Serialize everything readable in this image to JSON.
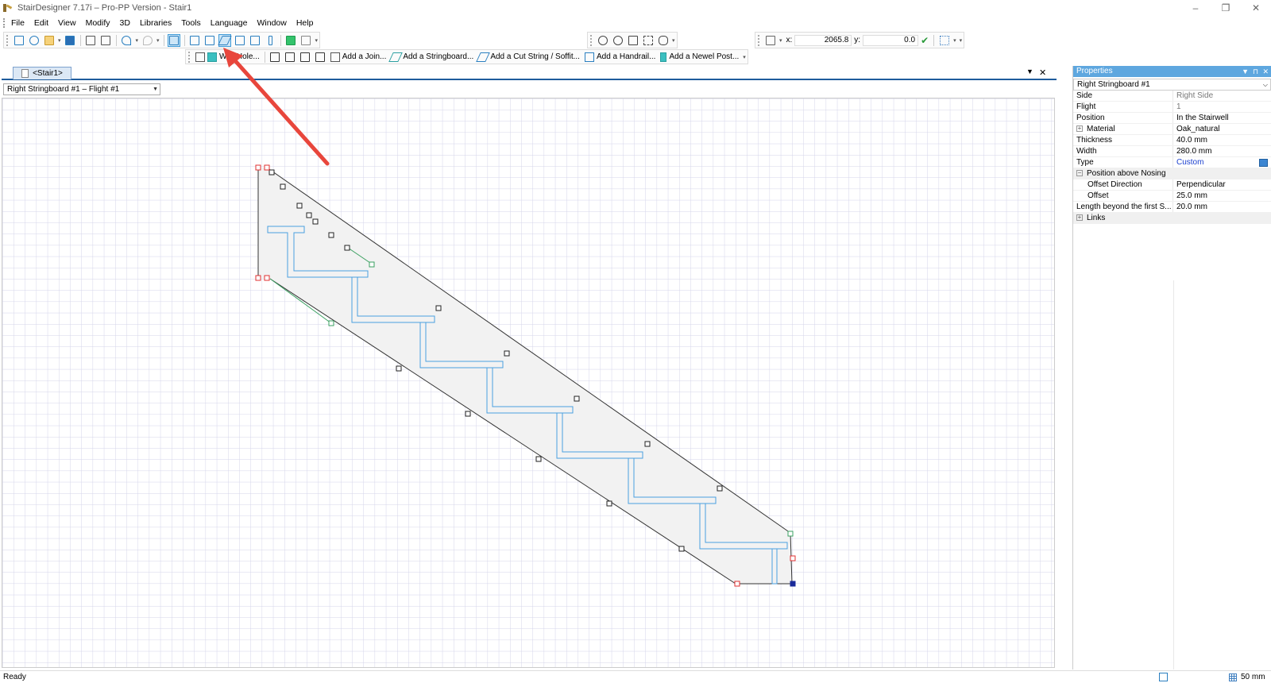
{
  "window": {
    "title": "StairDesigner 7.17i – Pro-PP Version - Stair1",
    "minimize": "–",
    "restore": "❐",
    "close": "✕"
  },
  "menu": [
    "File",
    "Edit",
    "View",
    "Modify",
    "3D",
    "Libraries",
    "Tools",
    "Language",
    "Window",
    "Help"
  ],
  "coords": {
    "x_label": "x:",
    "x_value": "2065.8",
    "y_label": "y:",
    "y_value": "0.0"
  },
  "toolbar2": {
    "wall_hole": "Wall Hole...",
    "join": "Add a Join...",
    "stringboard": "Add a Stringboard...",
    "cut_string": "Add a Cut String / Soffit...",
    "handrail": "Add a Handrail...",
    "newel": "Add a Newel Post..."
  },
  "document": {
    "tab_label": "<Stair1>",
    "flight_selector": "Right Stringboard #1 – Flight #1",
    "menu_arrow": "▼",
    "close": "✕"
  },
  "properties": {
    "title": "Properties",
    "selected": "Right Stringboard #1",
    "rows": [
      {
        "key": "Side",
        "value": "Right Side"
      },
      {
        "key": "Flight",
        "value": "1"
      },
      {
        "key": "Position",
        "value": "In the Stairwell"
      },
      {
        "key": "Material",
        "value": "Oak_natural",
        "expander": "+"
      },
      {
        "key": "Thickness",
        "value": "40.0 mm"
      },
      {
        "key": "Width",
        "value": "280.0 mm"
      },
      {
        "key": "Type",
        "value": "Custom"
      },
      {
        "key": "Position above Nosing",
        "value": "",
        "expander": "−"
      },
      {
        "key": "Offset Direction",
        "value": "Perpendicular"
      },
      {
        "key": "Offset",
        "value": "25.0 mm"
      },
      {
        "key": "Length beyond the first S...",
        "value": "20.0 mm"
      },
      {
        "key": "Links",
        "value": "",
        "expander": "+"
      }
    ]
  },
  "status": {
    "text": "Ready",
    "grid_size": "50 mm"
  },
  "colors": {
    "accent": "#5ea7df",
    "tab_border": "#1e5b9c",
    "arrow": "#e8463c",
    "grid": "#d4d4ea",
    "stringboard_fill": "#f2f2f2",
    "step": "#4aa0e0",
    "node": "#222222",
    "node_red": "#e03030",
    "node_green": "#3aa060"
  }
}
